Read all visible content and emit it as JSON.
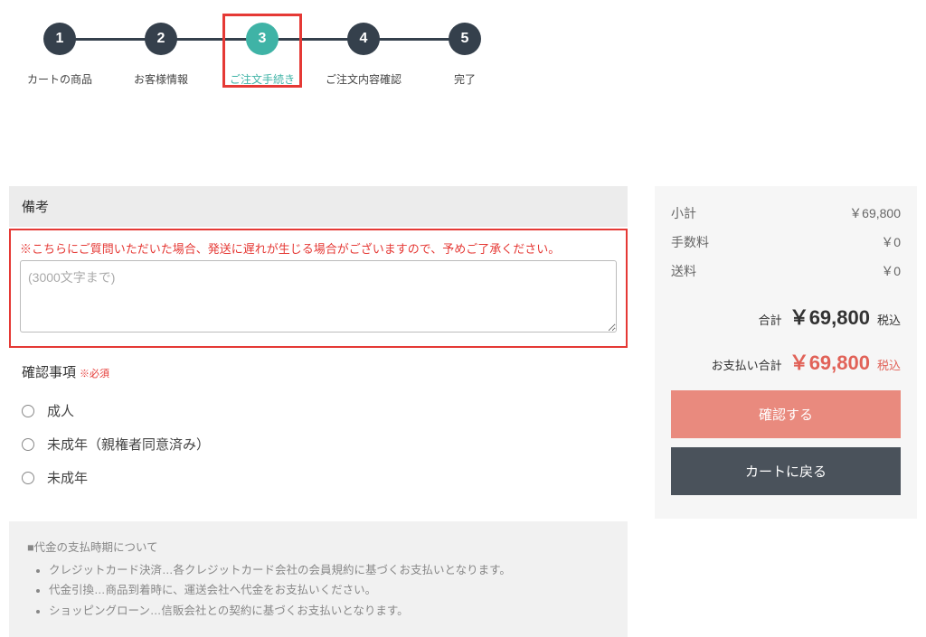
{
  "steps": [
    {
      "num": "1",
      "label": "カートの商品"
    },
    {
      "num": "2",
      "label": "お客様情報"
    },
    {
      "num": "3",
      "label": "ご注文手続き",
      "active": true,
      "highlighted": true
    },
    {
      "num": "4",
      "label": "ご注文内容確認"
    },
    {
      "num": "5",
      "label": "完了"
    }
  ],
  "remarks": {
    "title": "備考",
    "note": "※こちらにご質問いただいた場合、発送に遅れが生じる場合がございますので、予めご了承ください。",
    "placeholder": "(3000文字まで)"
  },
  "confirmation": {
    "title": "確認事項",
    "required_label": "※必須",
    "options": [
      "成人",
      "未成年（親権者同意済み）",
      "未成年"
    ]
  },
  "info": {
    "title": "■代金の支払時期について",
    "lines": [
      "クレジットカード決済…各クレジットカード会社の会員規約に基づくお支払いとなります。",
      "代金引換…商品到着時に、運送会社へ代金をお支払いください。",
      "ショッピングローン…信販会社との契約に基づくお支払いとなります。"
    ]
  },
  "summary": {
    "subtotal_label": "小計",
    "subtotal_value": "￥69,800",
    "fee_label": "手数料",
    "fee_value": "￥0",
    "shipping_label": "送料",
    "shipping_value": "￥0",
    "total_label": "合計",
    "total_value": "￥69,800",
    "tax_label": "税込",
    "pay_label": "お支払い合計",
    "pay_value": "￥69,800",
    "confirm_button": "確認する",
    "back_button": "カートに戻る"
  }
}
